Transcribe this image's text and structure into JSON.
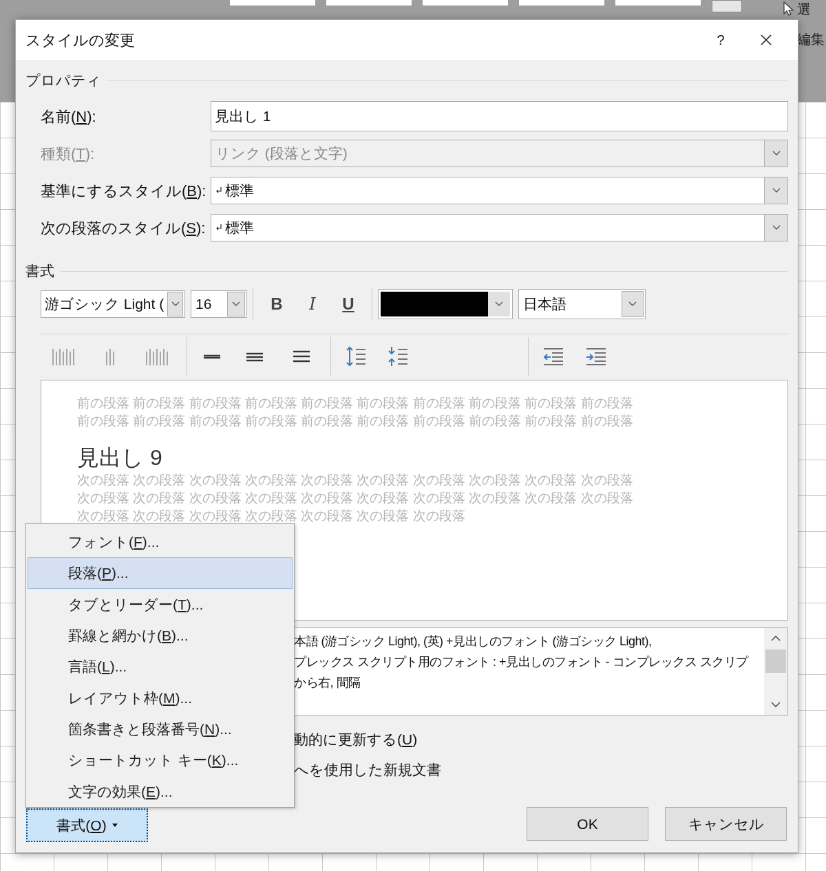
{
  "background": {
    "ribbon_labels": [
      "選",
      "編集"
    ]
  },
  "window": {
    "title": "スタイルの変更",
    "help": "?"
  },
  "properties": {
    "heading": "プロパティ",
    "fields": [
      {
        "kind": "text",
        "label": {
          "before": "名前(",
          "key": "N",
          "after": "):"
        },
        "value": "見出し 1",
        "disabled": false
      },
      {
        "kind": "dropdown",
        "label": {
          "before": "種類(",
          "key": "T",
          "after": "):"
        },
        "value": "リンク (段落と文字)",
        "disabled": true
      },
      {
        "kind": "dropdown",
        "label": {
          "before": "基準にするスタイル(",
          "key": "B",
          "after": "):"
        },
        "value": "標準",
        "disabled": false,
        "paragraph_mark": true
      },
      {
        "kind": "dropdown",
        "label": {
          "before": "次の段落のスタイル(",
          "key": "S",
          "after": "):"
        },
        "value": "標準",
        "disabled": false,
        "paragraph_mark": true
      }
    ]
  },
  "formatting": {
    "heading": "書式",
    "font": "游ゴシック Light (",
    "size": "16",
    "bold": "B",
    "italic": "I",
    "underline": "U",
    "color": "#000000",
    "language": "日本語"
  },
  "preview": {
    "before_lines": [
      "前の段落 前の段落 前の段落 前の段落 前の段落 前の段落 前の段落 前の段落 前の段落 前の段落",
      "前の段落 前の段落 前の段落 前の段落 前の段落 前の段落 前の段落 前の段落 前の段落 前の段落"
    ],
    "heading": "見出し 9",
    "after_lines": [
      "次の段落 次の段落 次の段落 次の段落 次の段落 次の段落 次の段落 次の段落 次の段落 次の段落",
      "次の段落 次の段落 次の段落 次の段落 次の段落 次の段落 次の段落 次の段落 次の段落 次の段落",
      "次の段落 次の段落 次の段落 次の段落 次の段落 次の段落 次の段落"
    ]
  },
  "description": {
    "lines": [
      "本語 (游ゴシック Light), (英) +見出しのフォント (游ゴシック Light),",
      "プレックス スクリプト用のフォント : +見出しのフォント - コンプレックス スクリプ",
      "から右, 間隔"
    ]
  },
  "options": [
    {
      "before": "動的に更新する(",
      "key": "U",
      "after": ")"
    },
    {
      "before": "へを使用した新規文書"
    }
  ],
  "format_button": {
    "before": "書式(",
    "key": "O",
    "after": ")",
    "pressed": true
  },
  "buttons": [
    {
      "label": "OK"
    },
    {
      "label": "キャンセル"
    }
  ],
  "menu": {
    "items": [
      {
        "before": "フォント(",
        "key": "F",
        "after": ")...",
        "selected": false
      },
      {
        "before": "段落(",
        "key": "P",
        "after": ")...",
        "selected": true
      },
      {
        "before": "タブとリーダー(",
        "key": "T",
        "after": ")...",
        "selected": false
      },
      {
        "before": "罫線と網かけ(",
        "key": "B",
        "after": ")...",
        "selected": false
      },
      {
        "before": "言語(",
        "key": "L",
        "after": ")...",
        "selected": false
      },
      {
        "before": "レイアウト枠(",
        "key": "M",
        "after": ")...",
        "selected": false
      },
      {
        "before": "箇条書きと段落番号(",
        "key": "N",
        "after": ")...",
        "selected": false
      },
      {
        "before": "ショートカット キー(",
        "key": "K",
        "after": ")...",
        "selected": false
      },
      {
        "before": "文字の効果(",
        "key": "E",
        "after": ")...",
        "selected": false
      }
    ]
  }
}
